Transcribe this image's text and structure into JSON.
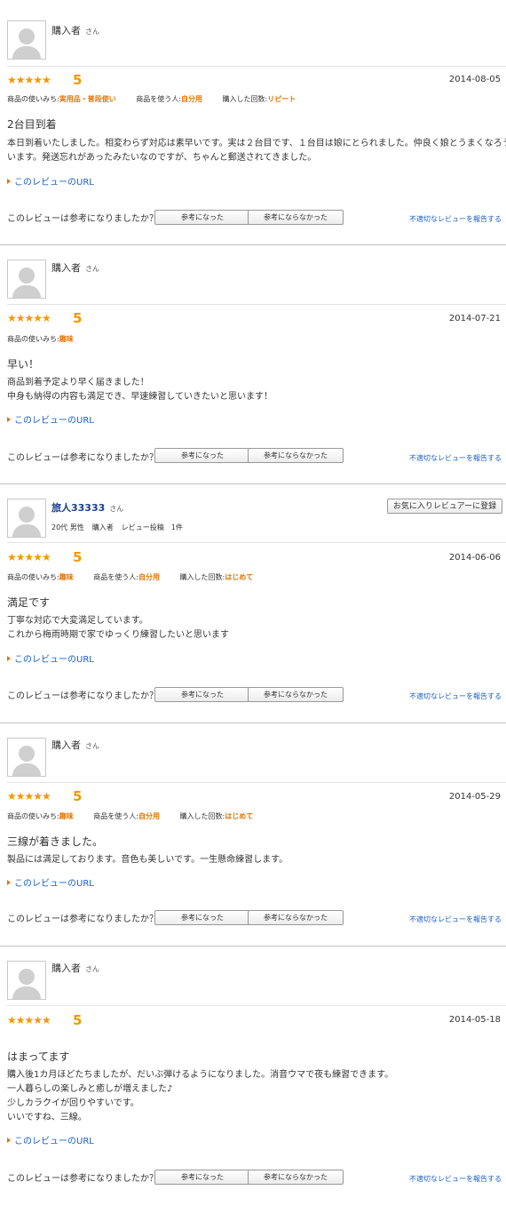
{
  "colors": {
    "accent": "#f39800",
    "link": "#1a5fc7",
    "usage_value": "#e67300"
  },
  "common": {
    "url_link_label": "このレビューのURL",
    "helpful_question": "このレビューは参考になりましたか？",
    "helpful_yes_label": "参考になった",
    "helpful_no_label": "参考にならなかった",
    "report_label": "不適切なレビューを報告する",
    "name_suffix": "さん"
  },
  "reviews": [
    {
      "reviewer": "購入者",
      "stars": "★★★★★",
      "score": "5",
      "date": "2014-08-05",
      "usage": [
        {
          "label": "商品の使いみち:",
          "value": "実用品・普段使い"
        },
        {
          "label": "商品を使う人:",
          "value": "自分用"
        },
        {
          "label": "購入した回数:",
          "value": "リピート"
        }
      ],
      "title": "2台目到着",
      "body": [
        "本日到着いたしました。相変わらず対応は素早いです。実は２台目です、１台目は娘にとられました。仲良く娘とうまくなろうと思",
        "います。発送忘れがあったみたいなのですが、ちゃんと郵送されてきました。"
      ]
    },
    {
      "reviewer": "購入者",
      "stars": "★★★★★",
      "score": "5",
      "date": "2014-07-21",
      "usage": [
        {
          "label": "商品の使いみち:",
          "value": "趣味"
        }
      ],
      "title": "早い！",
      "body": [
        "商品到着予定より早く届きました！",
        "中身も納得の内容も満足でき、早速練習していきたいと思います！"
      ]
    },
    {
      "reviewer": "旅人33333",
      "favorite_button": "お気に入りレビュアーに登録",
      "meta": [
        "20代 男性",
        "購入者",
        "レビュー投稿　1件"
      ],
      "stars": "★★★★★",
      "score": "5",
      "date": "2014-06-06",
      "usage": [
        {
          "label": "商品の使いみち:",
          "value": "趣味"
        },
        {
          "label": "商品を使う人:",
          "value": "自分用"
        },
        {
          "label": "購入した回数:",
          "value": "はじめて"
        }
      ],
      "title": "満足です",
      "body": [
        "丁寧な対応で大変満足しています。",
        "これから梅雨時期で家でゆっくり練習したいと思います"
      ]
    },
    {
      "reviewer": "購入者",
      "stars": "★★★★★",
      "score": "5",
      "date": "2014-05-29",
      "usage": [
        {
          "label": "商品の使いみち:",
          "value": "趣味"
        },
        {
          "label": "商品を使う人:",
          "value": "自分用"
        },
        {
          "label": "購入した回数:",
          "value": "はじめて"
        }
      ],
      "title": "三線が着きました。",
      "body": [
        "製品には満足しております。音色も美しいです。一生懸命練習します。"
      ]
    },
    {
      "reviewer": "購入者",
      "stars": "★★★★★",
      "score": "5",
      "date": "2014-05-18",
      "usage": [],
      "title": "はまってます",
      "body": [
        "購入後1カ月ほどたちましたが、だいぶ弾けるようになりました。消音ウマで夜も練習できます。",
        "一人暮らしの楽しみと癒しが増えました♪",
        "少しカラクイが回りやすいです。",
        "いいですね、三線。"
      ]
    }
  ]
}
